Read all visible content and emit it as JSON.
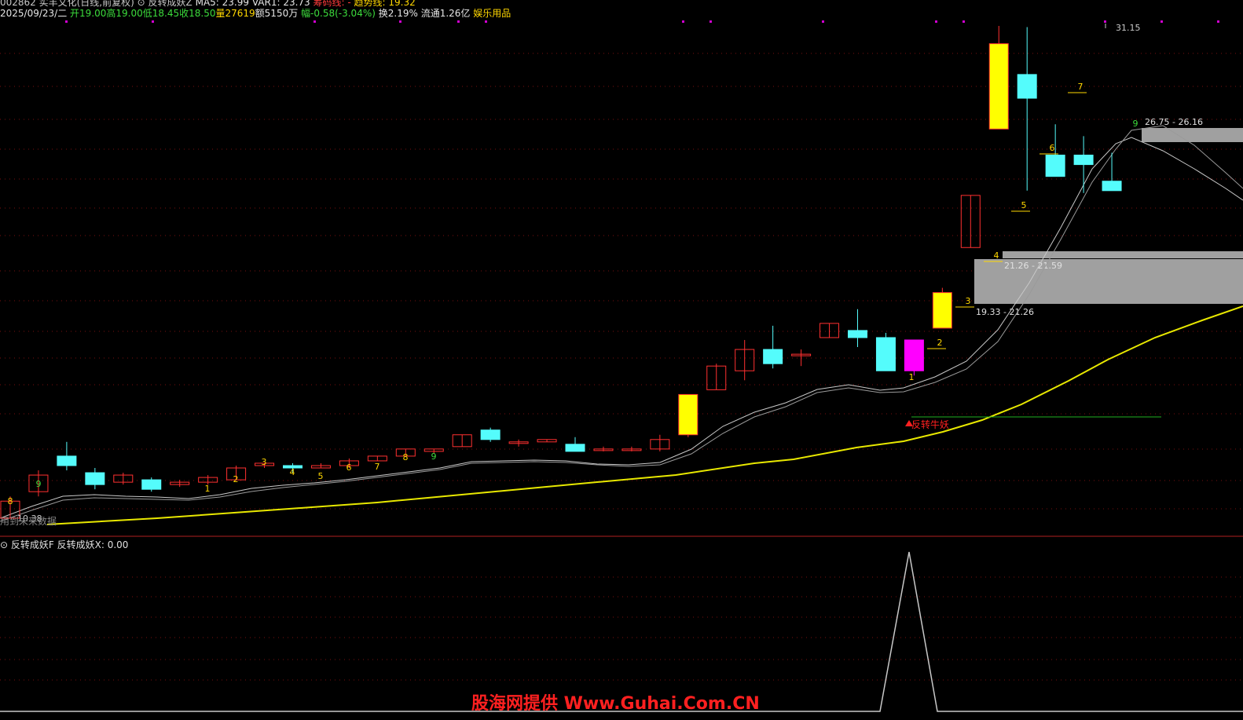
{
  "header": {
    "line1": {
      "stock": "002862 实丰文化(日线,前复权)",
      "indicator": "反转成妖Z",
      "ma5": "MA5: 23.99",
      "var1": "VAR1: 23.73",
      "cost_line": "筹码线: -",
      "trend_line": "趋势线: 19.32"
    },
    "line2": {
      "date": "2025/09/23/二",
      "open": "开19.00",
      "high": "高19.00",
      "low": "低18.45",
      "close": "收18.50",
      "volume": "量27619",
      "amount": "额5150万",
      "change": "幅-0.58(-3.04%)",
      "turnover": "换2.19%",
      "float": "流通1.26亿",
      "sector": "娱乐用品"
    }
  },
  "main_chart": {
    "high_label": "31.15",
    "low_label": "10.38",
    "left_note": "用到未来数据",
    "zones": [
      {
        "label": "26.75 - 26.16"
      },
      {
        "label": "21.26 - 21.59"
      },
      {
        "label": "19.33 - 21.26"
      }
    ],
    "signal_label": "反转牛妖",
    "count_labels": [
      "8",
      "9",
      "1",
      "2",
      "3",
      "4",
      "5",
      "6",
      "7",
      "8",
      "9",
      "1",
      "2",
      "3",
      "4",
      "5",
      "6",
      "7",
      "9"
    ]
  },
  "sub_chart": {
    "title": "反转成妖F",
    "value": "反转成妖X: 0.00"
  },
  "watermark": "股海网提供 Www.Guhai.Com.CN",
  "colors": {
    "up": "#ff3030",
    "down": "#54fcfc",
    "highlight": "#ffff00",
    "signal": "#ff00ff",
    "trend": "#e8e800",
    "zone": "#a0a0a0"
  },
  "chart_data": {
    "type": "candlestick",
    "price_range": [
      10.38,
      31.15
    ],
    "candles": [
      {
        "o": 10.38,
        "h": 11.3,
        "l": 10.38,
        "c": 11.1
      },
      {
        "o": 11.5,
        "h": 12.4,
        "l": 11.3,
        "c": 12.2
      },
      {
        "o": 13.0,
        "h": 13.6,
        "l": 12.4,
        "c": 12.6
      },
      {
        "o": 12.3,
        "h": 12.5,
        "l": 11.6,
        "c": 11.8
      },
      {
        "o": 11.9,
        "h": 12.3,
        "l": 11.8,
        "c": 12.2
      },
      {
        "o": 12.0,
        "h": 12.1,
        "l": 11.5,
        "c": 11.6
      },
      {
        "o": 11.8,
        "h": 12.0,
        "l": 11.7,
        "c": 11.9
      },
      {
        "o": 11.9,
        "h": 12.2,
        "l": 11.8,
        "c": 12.1
      },
      {
        "o": 12.0,
        "h": 12.6,
        "l": 12.0,
        "c": 12.5
      },
      {
        "o": 12.6,
        "h": 12.7,
        "l": 12.5,
        "c": 12.7
      },
      {
        "o": 12.6,
        "h": 12.7,
        "l": 12.3,
        "c": 12.5
      },
      {
        "o": 12.5,
        "h": 12.7,
        "l": 12.5,
        "c": 12.6
      },
      {
        "o": 12.6,
        "h": 12.9,
        "l": 12.5,
        "c": 12.8
      },
      {
        "o": 12.8,
        "h": 13.0,
        "l": 12.8,
        "c": 13.0
      },
      {
        "o": 13.0,
        "h": 13.3,
        "l": 13.0,
        "c": 13.3
      },
      {
        "o": 13.2,
        "h": 13.3,
        "l": 13.1,
        "c": 13.3
      },
      {
        "o": 13.4,
        "h": 13.9,
        "l": 13.4,
        "c": 13.9
      },
      {
        "o": 14.1,
        "h": 14.2,
        "l": 13.6,
        "c": 13.7
      },
      {
        "o": 13.6,
        "h": 13.7,
        "l": 13.4,
        "c": 13.6
      },
      {
        "o": 13.6,
        "h": 13.7,
        "l": 13.6,
        "c": 13.7
      },
      {
        "o": 13.5,
        "h": 13.8,
        "l": 13.3,
        "c": 13.2
      },
      {
        "o": 13.3,
        "h": 13.4,
        "l": 13.2,
        "c": 13.3
      },
      {
        "o": 13.3,
        "h": 13.4,
        "l": 13.2,
        "c": 13.3
      },
      {
        "o": 13.3,
        "h": 13.9,
        "l": 13.2,
        "c": 13.7
      },
      {
        "o": 13.9,
        "h": 15.6,
        "l": 13.8,
        "c": 15.6
      },
      {
        "o": 15.8,
        "h": 16.9,
        "l": 15.8,
        "c": 16.8
      },
      {
        "o": 16.6,
        "h": 17.9,
        "l": 16.2,
        "c": 17.5
      },
      {
        "o": 17.5,
        "h": 18.5,
        "l": 16.7,
        "c": 16.9
      },
      {
        "o": 17.3,
        "h": 17.5,
        "l": 16.8,
        "c": 17.3
      },
      {
        "o": 18.0,
        "h": 18.6,
        "l": 18.0,
        "c": 18.6
      },
      {
        "o": 18.3,
        "h": 19.2,
        "l": 17.6,
        "c": 18.0
      },
      {
        "o": 18.0,
        "h": 18.2,
        "l": 16.6,
        "c": 16.6
      },
      {
        "o": 16.6,
        "h": 17.9,
        "l": 16.4,
        "c": 17.9
      },
      {
        "o": 18.4,
        "h": 20.1,
        "l": 18.4,
        "c": 19.9
      },
      {
        "o": 21.8,
        "h": 24.0,
        "l": 21.8,
        "c": 24.0
      },
      {
        "o": 26.8,
        "h": 31.15,
        "l": 26.8,
        "c": 30.4
      },
      {
        "o": 29.1,
        "h": 31.1,
        "l": 24.2,
        "c": 28.1
      },
      {
        "o": 25.7,
        "h": 27.0,
        "l": 25.0,
        "c": 24.8
      },
      {
        "o": 25.7,
        "h": 26.5,
        "l": 24.1,
        "c": 25.3
      },
      {
        "o": 24.6,
        "h": 25.8,
        "l": 24.2,
        "c": 24.2
      }
    ],
    "trend_line_last": 19.32,
    "sub_indicator": {
      "name": "反转成妖X",
      "value": 0.0
    }
  }
}
